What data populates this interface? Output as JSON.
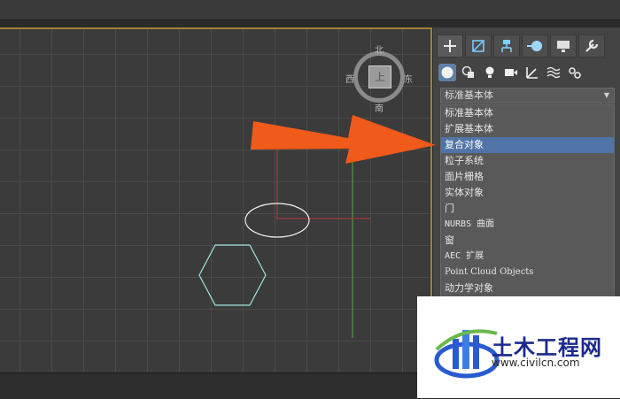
{
  "compass": {
    "north": "北",
    "south": "南",
    "east": "东",
    "west": "西",
    "top_face": "上"
  },
  "command_panel": {
    "tabs": [
      {
        "icon": "create-icon",
        "active": true
      },
      {
        "icon": "modify-icon",
        "active": false
      },
      {
        "icon": "hierarchy-icon",
        "active": false
      },
      {
        "icon": "motion-icon",
        "active": false
      },
      {
        "icon": "display-icon",
        "active": false
      },
      {
        "icon": "utilities-icon",
        "active": false
      }
    ],
    "subcategories": [
      "geometry-icon",
      "shapes-icon",
      "lights-icon",
      "cameras-icon",
      "helpers-icon",
      "space-warps-icon",
      "systems-icon"
    ],
    "dropdown": {
      "selected": "标准基本体",
      "options": [
        "标准基本体",
        "扩展基本体",
        "复合对象",
        "粒子系统",
        "面片栅格",
        "实体对象",
        "门",
        "NURBS 曲面",
        "窗",
        "AEC 扩展",
        "Point Cloud Objects",
        "动力学对象"
      ],
      "highlighted_index": 2
    }
  },
  "annotation": {
    "arrow_color": "#f05a1a"
  },
  "watermark": {
    "title": "土木工程网",
    "url": "www.civilcn.com"
  }
}
